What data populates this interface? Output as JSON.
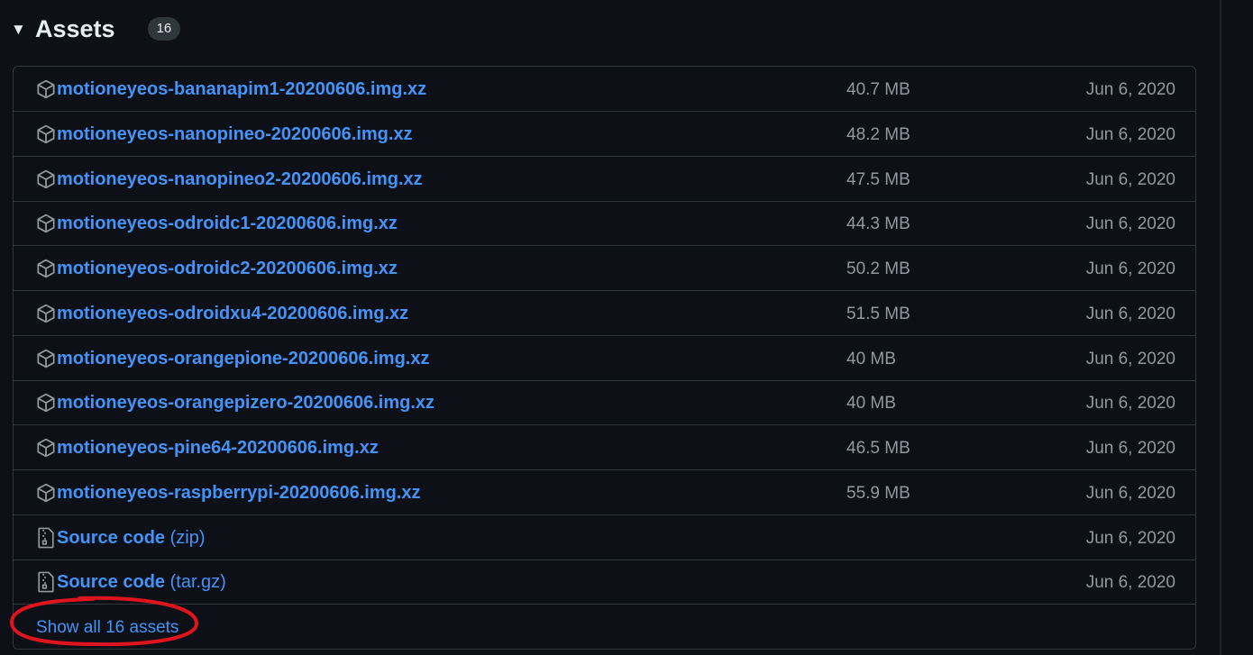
{
  "section": {
    "title": "Assets",
    "count": "16"
  },
  "assets": [
    {
      "icon": "package-icon",
      "name": "motioneyeos-bananapim1-20200606.img.xz",
      "suffix": "",
      "size": "40.7 MB",
      "date": "Jun 6, 2020"
    },
    {
      "icon": "package-icon",
      "name": "motioneyeos-nanopineo-20200606.img.xz",
      "suffix": "",
      "size": "48.2 MB",
      "date": "Jun 6, 2020"
    },
    {
      "icon": "package-icon",
      "name": "motioneyeos-nanopineo2-20200606.img.xz",
      "suffix": "",
      "size": "47.5 MB",
      "date": "Jun 6, 2020"
    },
    {
      "icon": "package-icon",
      "name": "motioneyeos-odroidc1-20200606.img.xz",
      "suffix": "",
      "size": "44.3 MB",
      "date": "Jun 6, 2020"
    },
    {
      "icon": "package-icon",
      "name": "motioneyeos-odroidc2-20200606.img.xz",
      "suffix": "",
      "size": "50.2 MB",
      "date": "Jun 6, 2020"
    },
    {
      "icon": "package-icon",
      "name": "motioneyeos-odroidxu4-20200606.img.xz",
      "suffix": "",
      "size": "51.5 MB",
      "date": "Jun 6, 2020"
    },
    {
      "icon": "package-icon",
      "name": "motioneyeos-orangepione-20200606.img.xz",
      "suffix": "",
      "size": "40 MB",
      "date": "Jun 6, 2020"
    },
    {
      "icon": "package-icon",
      "name": "motioneyeos-orangepizero-20200606.img.xz",
      "suffix": "",
      "size": "40 MB",
      "date": "Jun 6, 2020"
    },
    {
      "icon": "package-icon",
      "name": "motioneyeos-pine64-20200606.img.xz",
      "suffix": "",
      "size": "46.5 MB",
      "date": "Jun 6, 2020"
    },
    {
      "icon": "package-icon",
      "name": "motioneyeos-raspberrypi-20200606.img.xz",
      "suffix": "",
      "size": "55.9 MB",
      "date": "Jun 6, 2020"
    },
    {
      "icon": "file-zip-icon",
      "name": "Source code",
      "suffix": " (zip)",
      "size": "",
      "date": "Jun 6, 2020"
    },
    {
      "icon": "file-zip-icon",
      "name": "Source code",
      "suffix": " (tar.gz)",
      "size": "",
      "date": "Jun 6, 2020"
    }
  ],
  "show_all_label": "Show all 16 assets",
  "colors": {
    "background": "#0d1117",
    "link": "#4493f8",
    "muted": "#9198a1",
    "border": "#30363d",
    "annotation": "#e0141e"
  }
}
